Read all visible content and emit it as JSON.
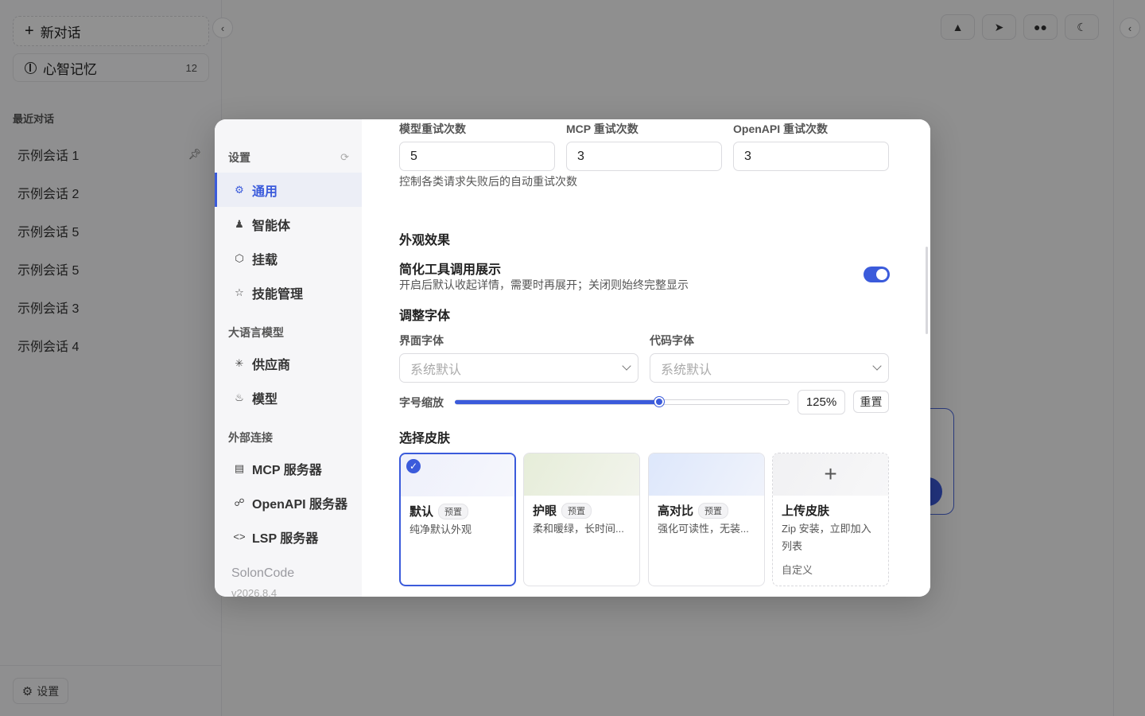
{
  "sidebar": {
    "new_chat": "新对话",
    "memory_label": "心智记忆",
    "memory_count": "12",
    "recent_title": "最近对话",
    "conversations": [
      "示例会话 1",
      "示例会话 2",
      "示例会话 5",
      "示例会话 5",
      "示例会话 3",
      "示例会话 4"
    ],
    "settings_label": "设置"
  },
  "settings": {
    "nav": {
      "head": "设置",
      "general": "通用",
      "agent": "智能体",
      "mount": "挂载",
      "skills": "技能管理",
      "group_llm": "大语言模型",
      "provider": "供应商",
      "model": "模型",
      "group_external": "外部连接",
      "mcp": "MCP 服务器",
      "openapi": "OpenAPI 服务器",
      "lsp": "LSP 服务器",
      "brand": "SolonCode",
      "version": "v2026.8.4"
    },
    "retry": {
      "model_label": "模型重试次数",
      "model_value": "5",
      "mcp_label": "MCP 重试次数",
      "mcp_value": "3",
      "openapi_label": "OpenAPI 重试次数",
      "openapi_value": "3",
      "hint": "控制各类请求失败后的自动重试次数"
    },
    "appearance": {
      "title": "外观效果",
      "simplify_title": "简化工具调用展示",
      "simplify_hint": "开启后默认收起详情，需要时再展开；关闭则始终完整显示",
      "simplify_on": true,
      "font_title": "调整字体",
      "ui_font_label": "界面字体",
      "ui_font_value": "系统默认",
      "code_font_label": "代码字体",
      "code_font_value": "系统默认",
      "scale_label": "字号缩放",
      "scale_value": "125%",
      "scale_fraction": 0.61,
      "reset_label": "重置",
      "skin_title": "选择皮肤",
      "skins": [
        {
          "name": "默认",
          "badge": "预置",
          "desc": "纯净默认外观"
        },
        {
          "name": "护眼",
          "badge": "预置",
          "desc": "柔和暖绿，长时间..."
        },
        {
          "name": "高对比",
          "badge": "预置",
          "desc": "强化可读性，无装..."
        },
        {
          "name": "上传皮肤",
          "desc": "Zip 安装，立即加入列表",
          "tag": "自定义"
        }
      ]
    }
  },
  "colors": {
    "accent": "#3b5bdb"
  }
}
